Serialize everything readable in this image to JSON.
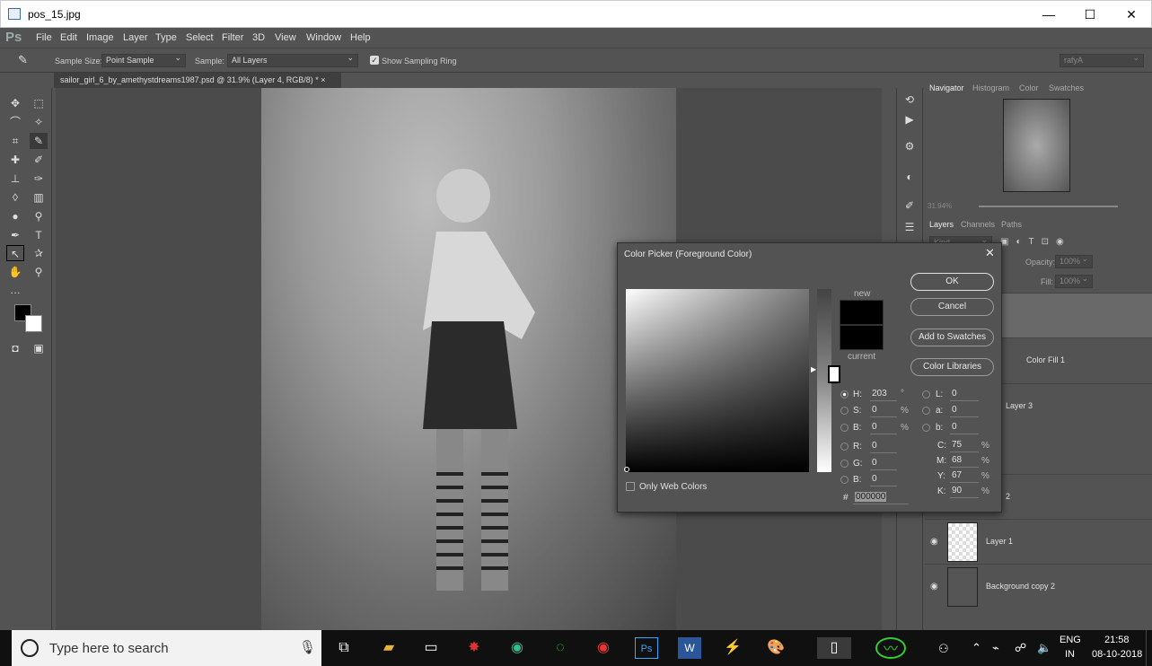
{
  "window": {
    "title": "pos_15.jpg",
    "minimize": "—",
    "maximize": "☐",
    "close": "✕"
  },
  "menu": {
    "logo": "Ps",
    "items": [
      "File",
      "Edit",
      "Image",
      "Layer",
      "Type",
      "Select",
      "Filter",
      "3D",
      "View",
      "Window",
      "Help"
    ]
  },
  "options": {
    "sample_size_label": "Sample Size:",
    "sample_size": "Point Sample",
    "sample_label": "Sample:",
    "sample": "All Layers",
    "show_ring": "Show Sampling Ring",
    "workspace": "rafyA"
  },
  "document": {
    "tab": "sailor_girl_6_by_amethystdreams1987.psd @ 31.9% (Layer 4, RGB/8) *",
    "close": "×"
  },
  "panels": {
    "tabs1": [
      "Navigator",
      "Histogram",
      "Color",
      "Swatches"
    ],
    "zoom": "31.94%",
    "tabs2": [
      "Layers",
      "Channels",
      "Paths"
    ],
    "kind": "Kind",
    "opacity_label": "Opacity:",
    "opacity": "100%",
    "fill_label": "Fill:",
    "fill": "100%"
  },
  "layers": [
    {
      "name": "4",
      "visible": false
    },
    {
      "name": "Color Fill 1",
      "visible": false
    },
    {
      "name": "Layer 3",
      "visible": false
    },
    {
      "name": "2",
      "visible": false
    },
    {
      "name": "Layer 1",
      "visible": true
    },
    {
      "name": "Background copy 2",
      "visible": true
    }
  ],
  "dialog": {
    "title": "Color Picker (Foreground Color)",
    "new_label": "new",
    "current_label": "current",
    "buttons": {
      "ok": "OK",
      "cancel": "Cancel",
      "add_swatches": "Add to Swatches",
      "color_libraries": "Color Libraries"
    },
    "hsb": [
      {
        "label": "H:",
        "value": "203",
        "unit": "°"
      },
      {
        "label": "S:",
        "value": "0",
        "unit": "%"
      },
      {
        "label": "B:",
        "value": "0",
        "unit": "%"
      }
    ],
    "rgb": [
      {
        "label": "R:",
        "value": "0"
      },
      {
        "label": "G:",
        "value": "0"
      },
      {
        "label": "B:",
        "value": "0"
      }
    ],
    "lab": [
      {
        "label": "L:",
        "value": "0"
      },
      {
        "label": "a:",
        "value": "0"
      },
      {
        "label": "b:",
        "value": "0"
      }
    ],
    "cmyk": [
      {
        "label": "C:",
        "value": "75",
        "unit": "%"
      },
      {
        "label": "M:",
        "value": "68",
        "unit": "%"
      },
      {
        "label": "Y:",
        "value": "67",
        "unit": "%"
      },
      {
        "label": "K:",
        "value": "90",
        "unit": "%"
      }
    ],
    "hex_label": "#",
    "hex": "000000",
    "web_only": "Only Web Colors",
    "color_new": "#000000",
    "color_current": "#000000"
  },
  "taskbar": {
    "search_placeholder": "Type here to search",
    "lang": "ENG",
    "region": "IN",
    "time": "21:58",
    "date": "08-10-2018"
  }
}
